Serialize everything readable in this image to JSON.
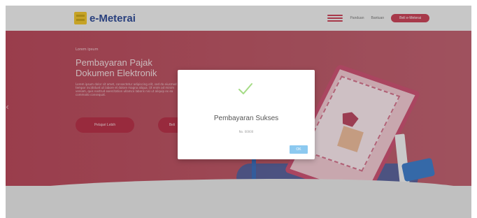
{
  "header": {
    "logo_text": "e-Meterai",
    "nav_links": [
      "Panduan",
      "Bantuan"
    ],
    "cta_label": "Beli e-Meterai",
    "accent_color": "#c7344b"
  },
  "hero": {
    "kicker": "Lorem ipsum",
    "title_line1": "Pembayaran Pajak",
    "title_line2": "Dokumen Elektronik",
    "description": "Lorem ipsum dolor sit amet, consectetur adipiscing elit, sed do eiusmod tempor incididunt ut labore et dolore magna aliqua. Ut enim ad minim veniam, quis nostrud exercitation ullamco laboris nisi ut aliquip ex ea commodo consequat.",
    "primary_button": "Pelajari Lebih",
    "secondary_button": "Beli",
    "background_color": "#b63a4e"
  },
  "modal": {
    "icon": "check-icon",
    "title": "Pembayaran Sukses",
    "subtitle": "No. 00000",
    "ok_label": "OK",
    "check_color": "#a5dc86",
    "ok_color": "#8cc9f0"
  }
}
